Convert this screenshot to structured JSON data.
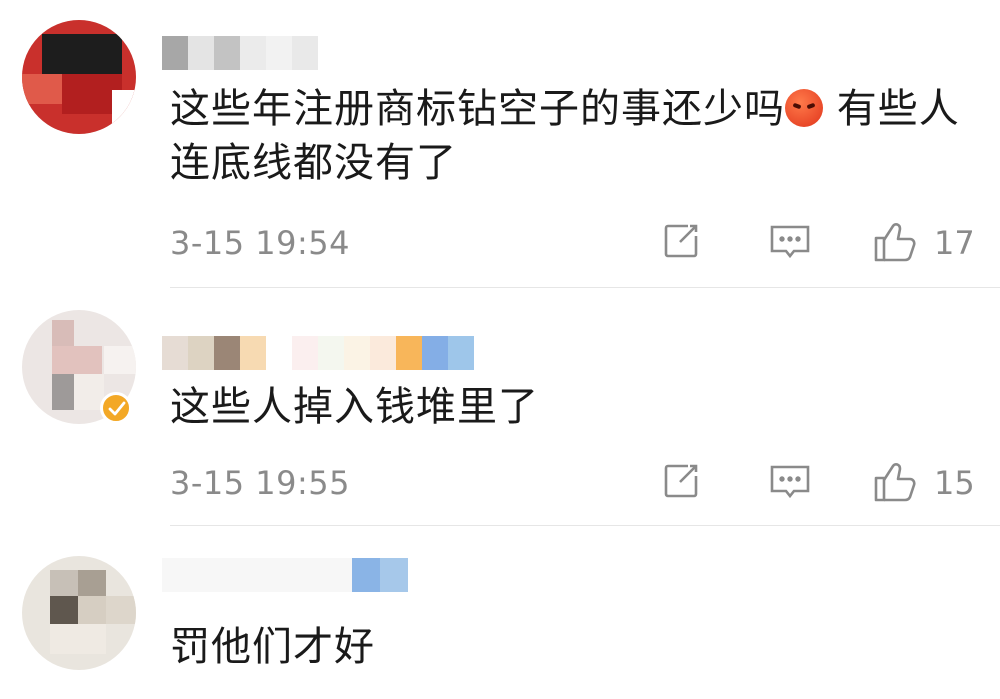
{
  "comments": [
    {
      "text": "这些年注册商标钻空子的事还少吗",
      "text_after_emoji": " 有些人连底线都没有了",
      "emoji": "angry-face",
      "timestamp": "3-15 19:54",
      "like_count": "17",
      "verified": false
    },
    {
      "text": "这些人掉入钱堆里了",
      "timestamp": "3-15 19:55",
      "like_count": "15",
      "verified": true
    },
    {
      "text": "罚他们才好",
      "verified": false
    }
  ],
  "colors": {
    "text": "#1a1a1a",
    "meta": "#8a8a8a",
    "divider": "#e6e6e6",
    "verified_badge": "#f3a826"
  },
  "icons": [
    "repost-icon",
    "comment-icon",
    "like-icon",
    "verified-icon"
  ]
}
